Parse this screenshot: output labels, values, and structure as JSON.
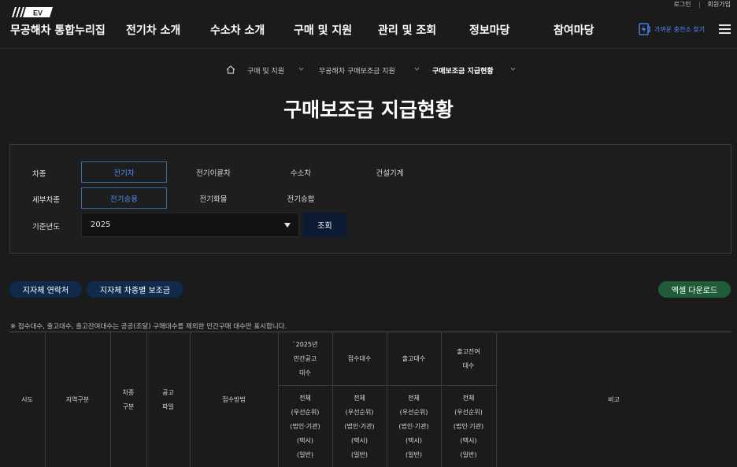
{
  "header": {
    "logo_badge": "EV",
    "logo_title": "무공해차 통합누리집",
    "login": "로그인",
    "signup": "회원가입",
    "nav": [
      "전기차 소개",
      "수소차 소개",
      "구매 및 지원",
      "관리 및 조회",
      "정보마당",
      "참여마당"
    ],
    "find_station": "가까운 충전소 찾기"
  },
  "breadcrumb": {
    "items": [
      "구매 및 지원",
      "무공해차 구매보조금 지원",
      "구매보조금 지급현황"
    ]
  },
  "page_title": "구매보조금 지급현황",
  "filter": {
    "vehicle_type_label": "차종",
    "vehicle_types": [
      "전기차",
      "전기이륜차",
      "수소차",
      "건설기계"
    ],
    "sub_type_label": "세부차종",
    "sub_types": [
      "전기승용",
      "전기화물",
      "전기승합"
    ],
    "year_label": "기준년도",
    "year_value": "2025",
    "search_label": "조회"
  },
  "actions": {
    "contact": "지자체 연락처",
    "subsidy_by_type": "지자체 차종별 보조금",
    "excel": "엑셀 다운로드"
  },
  "note": "※ 접수대수, 출고대수, 출고잔여대수는 공공(조달) 구매대수를 제외한 민간구매 대수만 표시합니다.",
  "table": {
    "headers": {
      "region": "시도",
      "area": "지역구분",
      "vehicle_type": [
        "차종",
        "구분"
      ],
      "notice_file": [
        "공고",
        "파일"
      ],
      "method": "접수방법",
      "notice_count": [
        "`2025년",
        "민간공고",
        "대수"
      ],
      "received": "접수대수",
      "released": "출고대수",
      "remaining": [
        "출고잔여",
        "대수"
      ],
      "remarks": "비고"
    },
    "breakdown": [
      "전체",
      "(우선순위)",
      "(법인·기관)",
      "(택시)",
      "(일반)"
    ]
  },
  "colors": {
    "background": "#1b1b1b",
    "accent_blue": "#4d8eff",
    "navy_button": "#0f2a4a",
    "green_button": "#1f5c3a"
  }
}
